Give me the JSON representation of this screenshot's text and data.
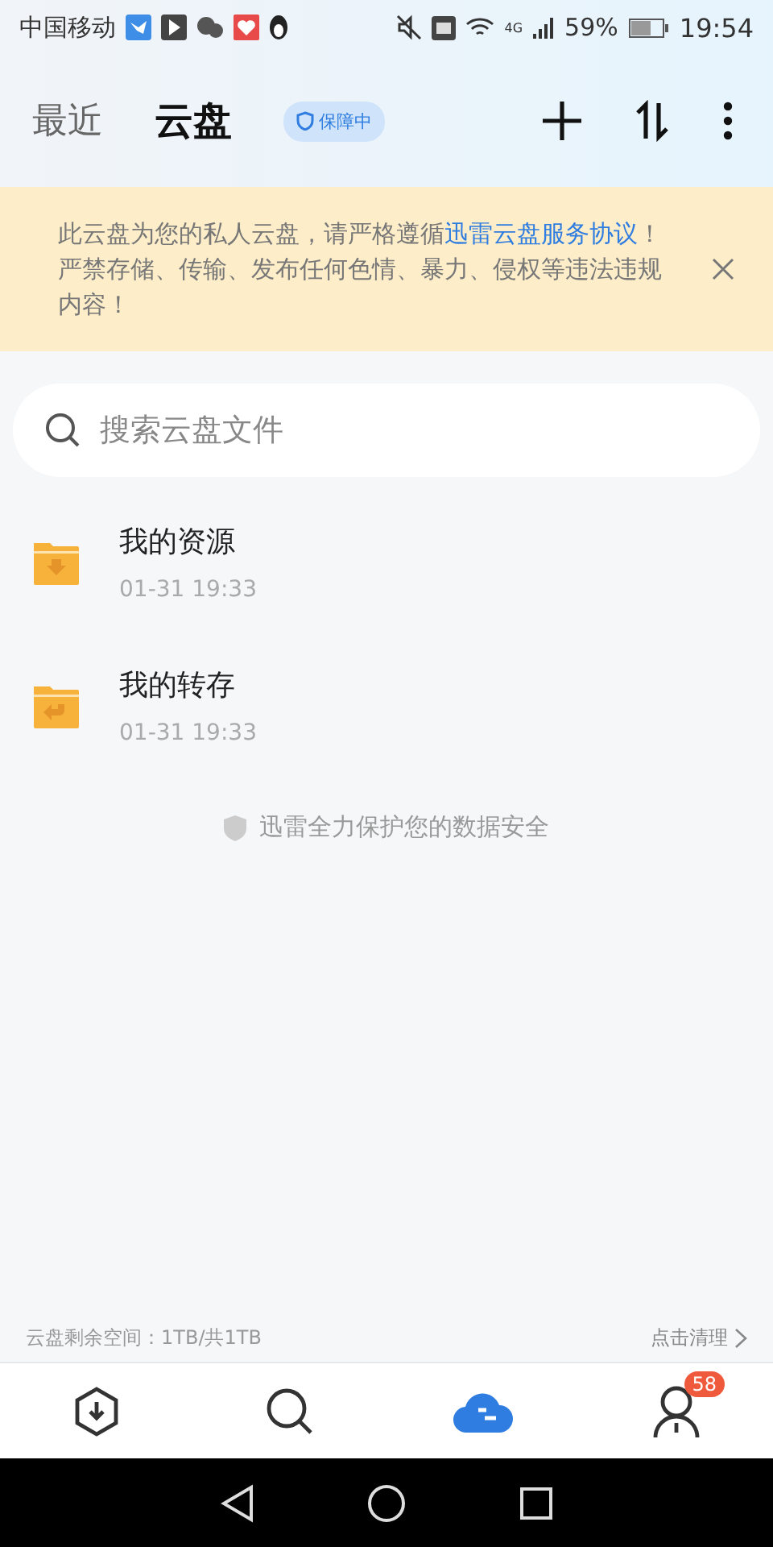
{
  "status_bar": {
    "carrier": "中国移动",
    "network": "4G",
    "battery": "59%",
    "time": "19:54"
  },
  "header": {
    "tabs": [
      {
        "label": "最近",
        "selected": false
      },
      {
        "label": "云盘",
        "selected": true
      }
    ],
    "badge": "保障中"
  },
  "notice": {
    "text_before": "此云盘为您的私人云盘，请严格遵循",
    "link": "迅雷云盘服务协议",
    "text_after": "！严禁存储、传输、发布任何色情、暴力、侵权等违法违规内容！"
  },
  "search": {
    "placeholder": "搜索云盘文件"
  },
  "folders": [
    {
      "name": "我的资源",
      "time": "01-31 19:33",
      "kind": "download"
    },
    {
      "name": "我的转存",
      "time": "01-31 19:33",
      "kind": "transfer"
    }
  ],
  "security_note": "迅雷全力保护您的数据安全",
  "storage": {
    "text": "云盘剩余空间：1TB/共1TB",
    "action": "点击清理"
  },
  "bottom_nav": [
    {
      "kind": "download",
      "selected": false
    },
    {
      "kind": "discover",
      "selected": false
    },
    {
      "kind": "cloud",
      "selected": true
    },
    {
      "kind": "profile",
      "selected": false,
      "badge": "58"
    }
  ]
}
